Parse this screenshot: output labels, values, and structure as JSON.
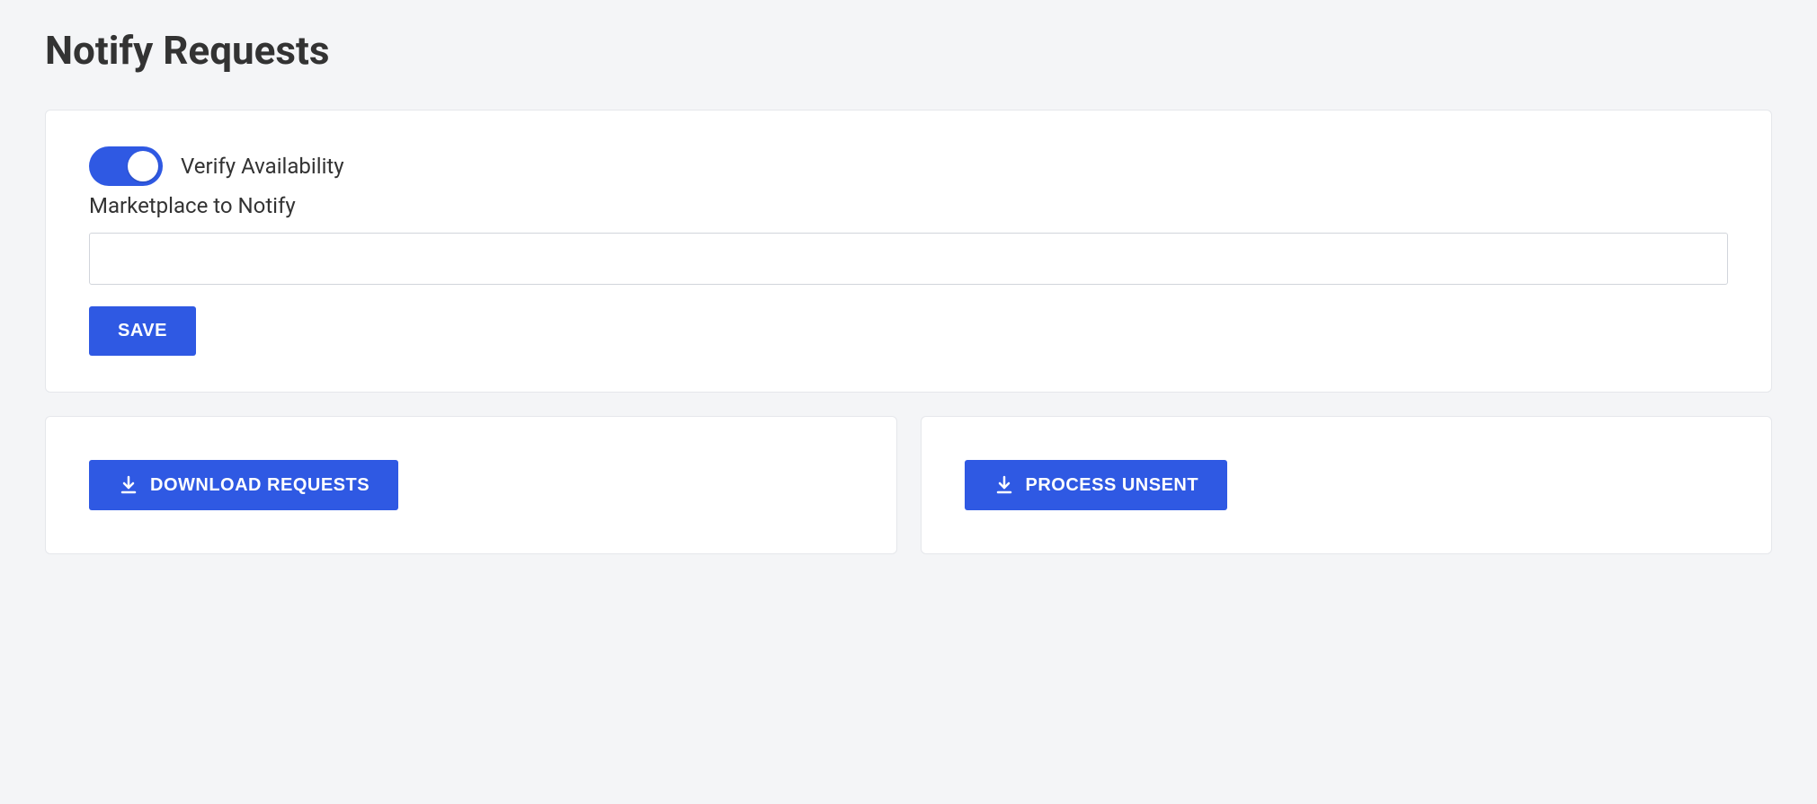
{
  "page": {
    "title": "Notify Requests"
  },
  "form": {
    "verify_toggle_label": "Verify Availability",
    "verify_toggle_on": true,
    "marketplace_label": "Marketplace to Notify",
    "marketplace_value": "",
    "save_label": "Save"
  },
  "actions": {
    "download_label": "Download Requests",
    "process_label": "Process Unsent"
  }
}
